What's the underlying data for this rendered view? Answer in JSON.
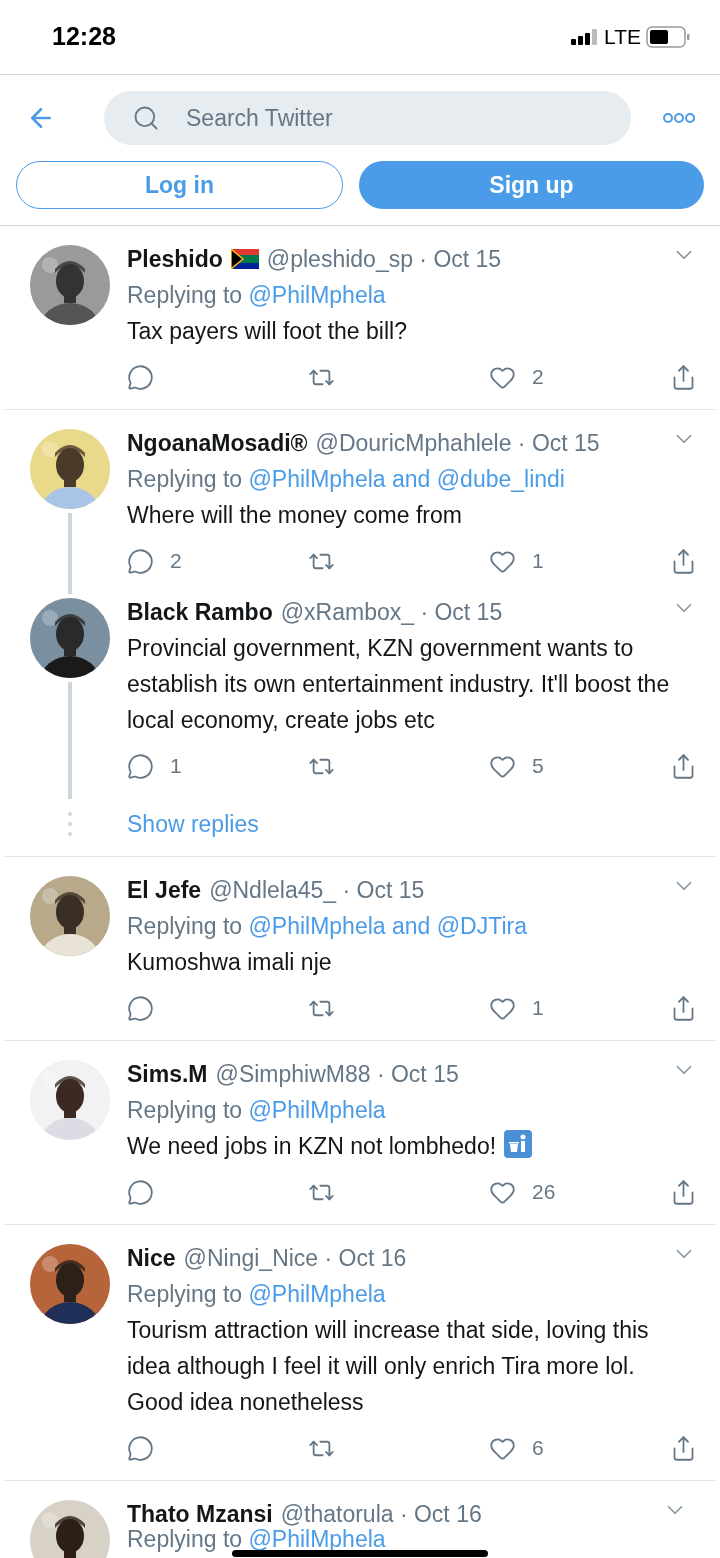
{
  "status_bar": {
    "time": "12:28",
    "network": "LTE"
  },
  "header": {
    "search": {
      "placeholder": "Search Twitter"
    },
    "login": "Log in",
    "signup": "Sign up"
  },
  "conversations": [
    {
      "tweets": [
        {
          "name": "Pleshido",
          "has_flag": true,
          "meta": "@pleshido_sp · Oct 15",
          "reply_label": "Replying to",
          "reply_targets": "@PhilMphela",
          "body": "Tax payers will foot the bill?",
          "trailing_icon": false,
          "like_count": "2"
        }
      ]
    },
    {
      "tweets": [
        {
          "name": "NgoanaMosadi®",
          "has_flag": false,
          "meta": "@DouricMphahlele · Oct 15",
          "reply_label": "Replying to",
          "reply_targets": "@PhilMphela and @dube_lindi",
          "body": "Where will the money come from",
          "trailing_icon": false,
          "reply_count": "2",
          "like_count": "1"
        },
        {
          "name": "Black Rambo",
          "has_flag": false,
          "meta": "@xRambox_ · Oct 15",
          "body": "Provincial government, KZN government wants  to establish its own entertainment industry. It'll boost the local economy, create jobs etc",
          "trailing_icon": false,
          "reply_count": "1",
          "like_count": "5"
        }
      ],
      "show_replies": "Show replies"
    },
    {
      "tweets": [
        {
          "name": "El Jefe",
          "has_flag": false,
          "meta": "@Ndlela45_ · Oct 15",
          "reply_label": "Replying to",
          "reply_targets": "@PhilMphela and @DJTira",
          "body": "Kumoshwa imali nje",
          "trailing_icon": false,
          "like_count": "1"
        }
      ]
    },
    {
      "tweets": [
        {
          "name": "Sims.M",
          "has_flag": false,
          "meta": "@SimphiwM88 · Oct 15",
          "reply_label": "Replying to",
          "reply_targets": "@PhilMphela",
          "body": "We need jobs in KZN not lombhedo!",
          "trailing_icon": true,
          "like_count": "26"
        }
      ]
    },
    {
      "tweets": [
        {
          "name": "Nice",
          "has_flag": false,
          "meta": "@Ningi_Nice · Oct 16",
          "reply_label": "Replying to",
          "reply_targets": "@PhilMphela",
          "body": "Tourism attraction will increase that side, loving this idea although I feel it will only enrich Tira more lol. Good idea nonetheless",
          "trailing_icon": false,
          "like_count": "6"
        }
      ]
    },
    {
      "tweets": [
        {
          "name": "Thato Mzansi",
          "has_flag": false,
          "meta": "@thatorula · Oct 16",
          "reply_label": "Replying to",
          "reply_targets": "@PhilMphela",
          "trailing_icon": false
        }
      ]
    }
  ]
}
